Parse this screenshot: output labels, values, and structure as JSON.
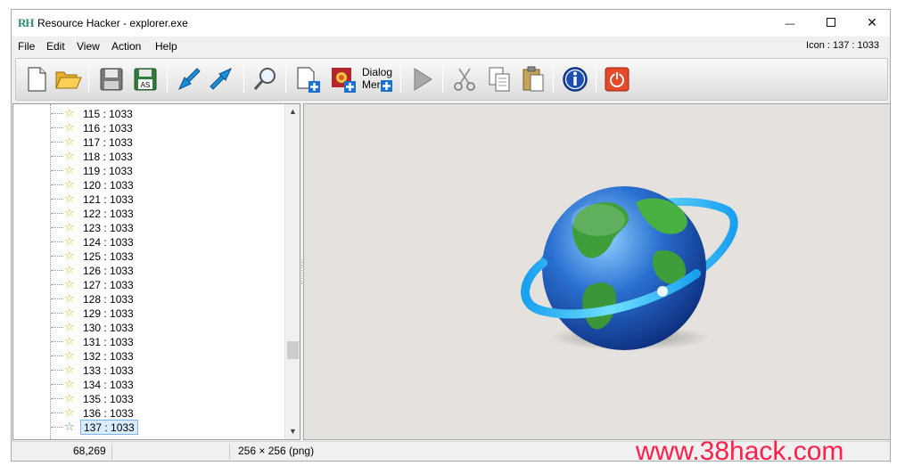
{
  "window": {
    "title": "Resource Hacker - explorer.exe",
    "logo": "RH",
    "controls": [
      "minimize-icon",
      "maximize-icon",
      "close-icon"
    ],
    "close_glyph": "✕",
    "minimize_glyph": "—"
  },
  "menu": {
    "items": [
      "File",
      "Edit",
      "Action",
      "View",
      "Help"
    ],
    "file": "File",
    "edit": "Edit",
    "view": "View",
    "action": "Action",
    "help": "Help",
    "resource_info": "Icon : 137 : 1033"
  },
  "toolbar": {
    "buttons": [
      {
        "name": "new-icon"
      },
      {
        "name": "open-icon"
      },
      {
        "name": "save-icon"
      },
      {
        "name": "save-as-icon",
        "label": "AS"
      },
      {
        "name": "import-icon"
      },
      {
        "name": "export-icon"
      },
      {
        "name": "search-icon"
      },
      {
        "name": "add-blank-resource-icon"
      },
      {
        "name": "add-image-resource-icon"
      },
      {
        "name": "dialog-menu-icon",
        "label_line1": "Dialog",
        "label_line2": "Mer"
      },
      {
        "name": "compile-run-icon"
      },
      {
        "name": "cut-icon"
      },
      {
        "name": "copy-icon"
      },
      {
        "name": "paste-icon"
      },
      {
        "name": "info-icon"
      },
      {
        "name": "exit-icon"
      }
    ]
  },
  "tree": {
    "items": [
      "115 : 1033",
      "116 : 1033",
      "117 : 1033",
      "118 : 1033",
      "119 : 1033",
      "120 : 1033",
      "121 : 1033",
      "122 : 1033",
      "123 : 1033",
      "124 : 1033",
      "125 : 1033",
      "126 : 1033",
      "127 : 1033",
      "128 : 1033",
      "129 : 1033",
      "130 : 1033",
      "131 : 1033",
      "132 : 1033",
      "133 : 1033",
      "134 : 1033",
      "135 : 1033",
      "136 : 1033",
      "137 : 1033"
    ],
    "selected_item": "137 : 1033",
    "item_icon": "star-icon"
  },
  "preview": {
    "image": "globe-icon"
  },
  "status": {
    "coords": "68,269",
    "image_info": "256 × 256 (png)"
  },
  "watermark": "www.38hack.com",
  "colors": {
    "selection_bg": "#d8ecfb",
    "selection_border": "#7ab6e8",
    "watermark": "#ff1f4d",
    "preview_bg": "#e5e2dd"
  }
}
